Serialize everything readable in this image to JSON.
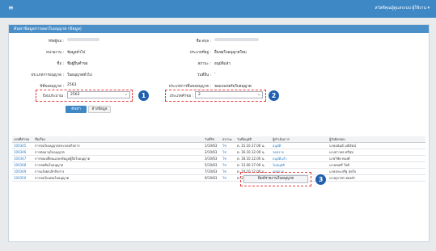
{
  "topbar": {
    "menu_icon": "hamburger-icon",
    "user_text": "สวัสดีคุณผู้ดูแลระบบ ผู้ใช้งาน ▾"
  },
  "panel": {
    "title": "ค้นหาข้อมูลการออกใบอนุญาต (ข้อมูล)"
  },
  "form": {
    "labels_left": [
      "รหัสผู้ขอ :",
      "หน่วยงาน :",
      "ชื่อ :",
      "ประเภทการอนุญาต :",
      "ปีที่ขออนุญาต :"
    ],
    "values_left": [
      "",
      "ข้อมูลทั่วไป",
      "ชื่อผู้ยื่นคำขอ",
      "ใบอนุญาตทั่วไป",
      "2563"
    ],
    "labels_right": [
      "ชื่อ-สกุล :",
      "ประเภทที่อยู่ :",
      "สถานะ :",
      "วันที่ยื่น :",
      "ประเภทการยื่นขออนุญาต :"
    ],
    "values_right": [
      "",
      "ยื่นขอใบอนุญาตใหม่",
      "อนุมัติแล้ว",
      "-",
      "ขอแบบฟอร์มใบอนุญาต"
    ],
    "year_label": "ปีงบประมาณ :",
    "year_value": "2563",
    "type_label": "ประเภทคำขอ :",
    "type_value": "2",
    "search_button": "ค้นหา",
    "reset_button": "ล้างข้อมูล"
  },
  "markers": [
    "1",
    "2",
    "3"
  ],
  "table": {
    "headers": [
      "เลขที่คำขอ",
      "ชื่อเรื่อง",
      "วันที่รับ",
      "สถานะ",
      "วันที่อนุมัติ",
      "ผู้ดำเนินการ",
      "ผู้รับผิดชอบ"
    ],
    "rows": [
      [
        "100345",
        "การขอใบอนุญาตประกอบกิจการ",
        "1/10/63",
        "ใช่",
        "ต. 15.10.17.00 น.",
        "อนุมัติ",
        "นายอนันต์ มณีรัตน์"
      ],
      [
        "100346",
        "การต่ออายุใบอนุญาต",
        "2/10/63",
        "ใช่",
        "ต. 16.10.12.00 น.",
        "รอตรวจ",
        "นางสาวพร ศรีสุข"
      ],
      [
        "100347",
        "การขอเปลี่ยนแปลงข้อมูลผู้ถือใบอนุญาต",
        "3/10/63",
        "ใช่",
        "ต. 18.10.12.00 น.",
        "อนุมัติแล้ว",
        "นายวิชัย ทองดี"
      ],
      [
        "100348",
        "การขอคืนใบอนุญาต",
        "5/10/63",
        "ใช่",
        "ต. 13.00.17.00 น.",
        "ไม่อนุมัติ",
        "นางสมศรี ใจดี"
      ],
      [
        "100349",
        "การแจ้งยกเลิกกิจการ",
        "7/10/63",
        "ใช่",
        "ต. 20.10.12.00 น.",
        "รอตรวจ",
        "นายประเสริฐ สุขใจ"
      ],
      [
        "100350",
        "การขอใบแทนใบอนุญาต",
        "9/10/63",
        "ใช่",
        "ต. 22.10.12.00 น.",
        "อนุมัติ",
        "นางสุภาพร ทองคำ"
      ]
    ]
  },
  "report_button": "พิมพ์รายงานใบอนุญาต"
}
